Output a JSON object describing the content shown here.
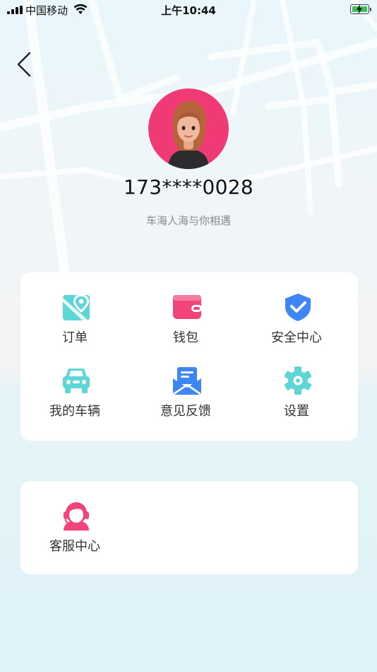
{
  "status_bar": {
    "carrier": "中国移动",
    "time": "上午10:44"
  },
  "profile": {
    "phone": "173****0028",
    "slogan": "车海人海与你相遇"
  },
  "menu": {
    "items": [
      {
        "label": "订单",
        "icon": "map-pin-icon",
        "color": "#5fd6d6"
      },
      {
        "label": "钱包",
        "icon": "wallet-icon",
        "color": "#f1457a"
      },
      {
        "label": "安全中心",
        "icon": "shield-check-icon",
        "color": "#3f86f5"
      },
      {
        "label": "我的车辆",
        "icon": "car-icon",
        "color": "#5fd6d6"
      },
      {
        "label": "意见反馈",
        "icon": "feedback-envelope-icon",
        "color": "#3f86f5"
      },
      {
        "label": "设置",
        "icon": "gear-icon",
        "color": "#5fd6d6"
      }
    ]
  },
  "service": {
    "label": "客服中心",
    "icon": "customer-service-icon",
    "color": "#f1457a"
  },
  "colors": {
    "accent_cyan": "#5fd6d6",
    "accent_pink": "#f1457a",
    "accent_blue": "#3f86f5"
  }
}
